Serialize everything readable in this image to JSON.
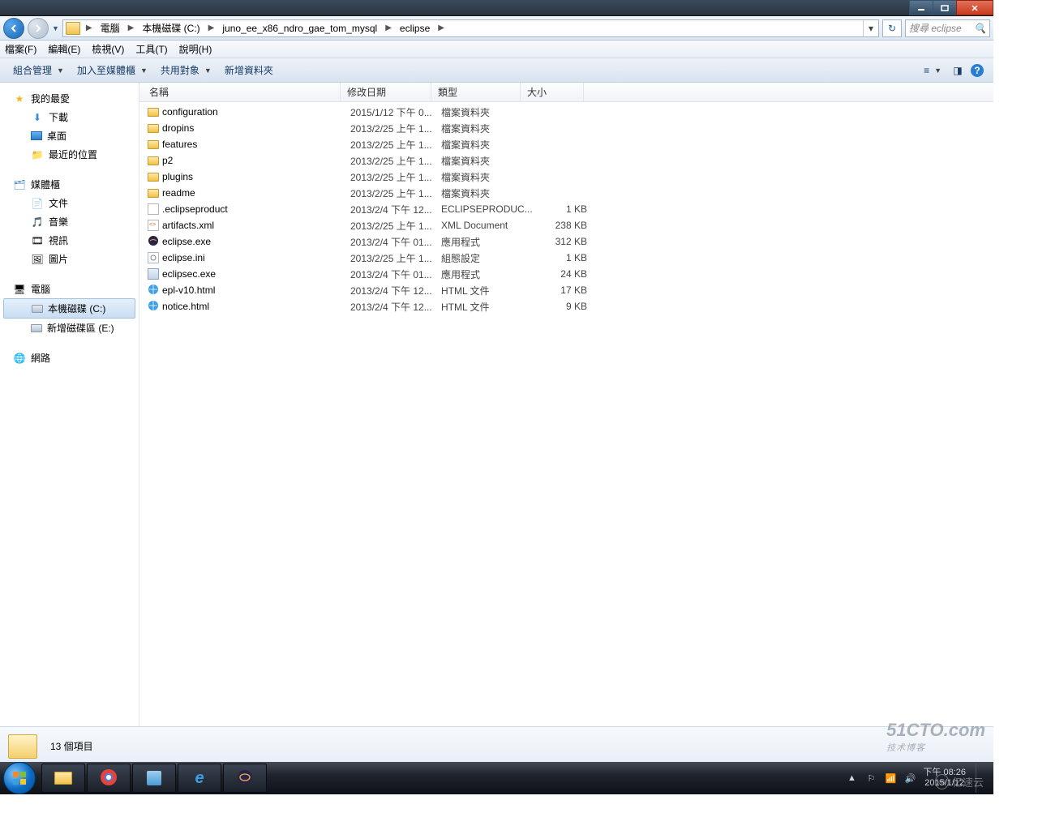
{
  "window": {
    "title": ""
  },
  "nav": {
    "path": [
      "電腦",
      "本機磁碟 (C:)",
      "juno_ee_x86_ndro_gae_tom_mysql",
      "eclipse"
    ],
    "search_placeholder": "搜尋 eclipse"
  },
  "menu": {
    "file": "檔案(F)",
    "edit": "編輯(E)",
    "view": "檢視(V)",
    "tools": "工具(T)",
    "help": "說明(H)"
  },
  "toolbar": {
    "organize": "組合管理",
    "include": "加入至媒體櫃",
    "share": "共用對象",
    "newfolder": "新增資料夾"
  },
  "sidebar": {
    "favorites": {
      "label": "我的最愛",
      "items": [
        "下載",
        "桌面",
        "最近的位置"
      ]
    },
    "libraries": {
      "label": "媒體櫃",
      "items": [
        "文件",
        "音樂",
        "視訊",
        "圖片"
      ]
    },
    "computer": {
      "label": "電腦",
      "items": [
        "本機磁碟 (C:)",
        "新增磁碟區 (E:)"
      ]
    },
    "network": {
      "label": "網路"
    }
  },
  "columns": {
    "name": "名稱",
    "date": "修改日期",
    "type": "類型",
    "size": "大小"
  },
  "files": [
    {
      "icon": "folder",
      "name": "configuration",
      "date": "2015/1/12 下午 0...",
      "type": "檔案資料夾",
      "size": ""
    },
    {
      "icon": "folder",
      "name": "dropins",
      "date": "2013/2/25 上午 1...",
      "type": "檔案資料夾",
      "size": ""
    },
    {
      "icon": "folder",
      "name": "features",
      "date": "2013/2/25 上午 1...",
      "type": "檔案資料夾",
      "size": ""
    },
    {
      "icon": "folder",
      "name": "p2",
      "date": "2013/2/25 上午 1...",
      "type": "檔案資料夾",
      "size": ""
    },
    {
      "icon": "folder",
      "name": "plugins",
      "date": "2013/2/25 上午 1...",
      "type": "檔案資料夾",
      "size": ""
    },
    {
      "icon": "folder",
      "name": "readme",
      "date": "2013/2/25 上午 1...",
      "type": "檔案資料夾",
      "size": ""
    },
    {
      "icon": "file",
      "name": ".eclipseproduct",
      "date": "2013/2/4 下午 12...",
      "type": "ECLIPSEPRODUC...",
      "size": "1 KB"
    },
    {
      "icon": "xml",
      "name": "artifacts.xml",
      "date": "2013/2/25 上午 1...",
      "type": "XML Document",
      "size": "238 KB"
    },
    {
      "icon": "exe",
      "name": "eclipse.exe",
      "date": "2013/2/4 下午 01...",
      "type": "應用程式",
      "size": "312 KB"
    },
    {
      "icon": "ini",
      "name": "eclipse.ini",
      "date": "2013/2/25 上午 1...",
      "type": "組態設定",
      "size": "1 KB"
    },
    {
      "icon": "exe2",
      "name": "eclipsec.exe",
      "date": "2013/2/4 下午 01...",
      "type": "應用程式",
      "size": "24 KB"
    },
    {
      "icon": "html",
      "name": "epl-v10.html",
      "date": "2013/2/4 下午 12...",
      "type": "HTML 文件",
      "size": "17 KB"
    },
    {
      "icon": "html",
      "name": "notice.html",
      "date": "2013/2/4 下午 12...",
      "type": "HTML 文件",
      "size": "9 KB"
    }
  ],
  "status": {
    "count": "13 個項目"
  },
  "tray": {
    "time": "下午 08:26",
    "date": "2015/1/12"
  },
  "watermark": {
    "main": "51CTO.com",
    "sub": "技术博客",
    "yisu": "亿速云"
  }
}
